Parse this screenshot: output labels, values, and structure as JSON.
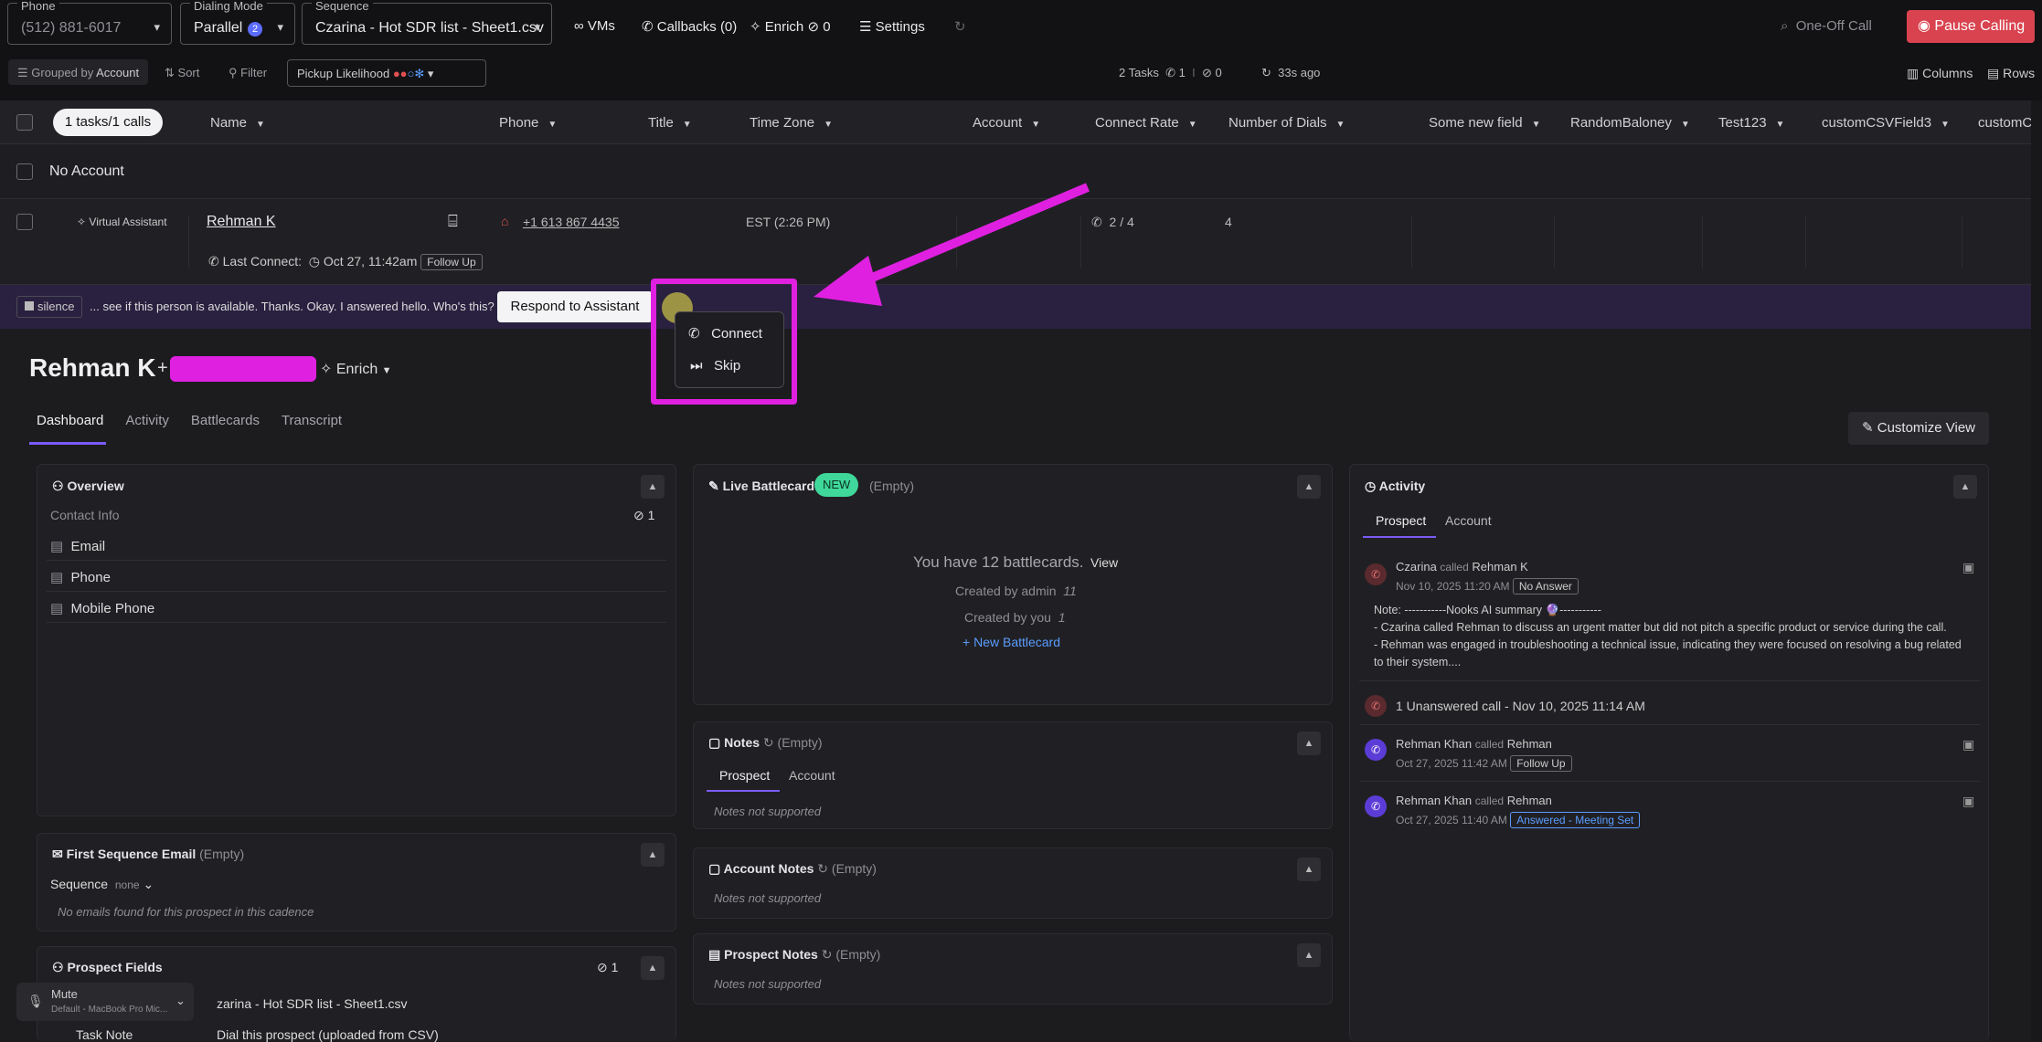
{
  "topbar": {
    "phone": {
      "label": "Phone",
      "value": "(512) 881-6017"
    },
    "dialing_mode": {
      "label": "Dialing Mode",
      "value": "Parallel",
      "count": "2"
    },
    "sequence": {
      "label": "Sequence",
      "value": "Czarina - Hot SDR list - Sheet1.csv"
    },
    "vms": "VMs",
    "callbacks": "Callbacks (0)",
    "enrich": "Enrich",
    "enrich_count": "0",
    "settings": "Settings",
    "one_off_call": "One-Off Call",
    "pause_calling": "Pause Calling"
  },
  "toolbar": {
    "grouped_by": "Grouped by",
    "grouped_value": "Account",
    "sort": "Sort",
    "filter": "Filter",
    "pickup": "Pickup Likelihood",
    "tasks": "2 Tasks",
    "phone_count": "1",
    "divider": "I",
    "hidden_count": "0",
    "ago": "33s ago",
    "columns": "Columns",
    "rows": "Rows"
  },
  "table": {
    "pill": "1 tasks/1 calls",
    "headers": [
      "Name",
      "Phone",
      "Title",
      "Time Zone",
      "Account",
      "Connect Rate",
      "Number of Dials",
      "Some new field",
      "RandomBaloney",
      "Test123",
      "customCSVField3",
      "customCS"
    ],
    "group": "No Account",
    "row": {
      "badge": "Virtual Assistant",
      "name": "Rehman K",
      "phone": "+1 613 867 4435",
      "timezone": "EST (2:26 PM)",
      "connect": "2 / 4",
      "dials": "4",
      "last_connect_label": "Last Connect:",
      "last_connect": "Oct 27, 11:42am",
      "status": "Follow Up"
    }
  },
  "assistant": {
    "silence": "silence",
    "transcript": "... see if this person is available. Thanks. Okay. I answered hello. Who's this?",
    "respond": "Respond to Assistant",
    "menu": [
      "Connect",
      "Skip"
    ]
  },
  "prospect": {
    "name": "Rehman K",
    "enrich": "Enrich",
    "tabs": [
      "Dashboard",
      "Activity",
      "Battlecards",
      "Transcript"
    ],
    "customize": "Customize View"
  },
  "overview": {
    "title": "Overview",
    "contact_info": "Contact Info",
    "hidden": "1",
    "items": [
      "Email",
      "Phone",
      "Mobile Phone"
    ]
  },
  "first_email": {
    "title": "First Sequence Email",
    "empty": "(Empty)",
    "sequence_label": "Sequence",
    "sequence_value": "none",
    "no_emails": "No emails found for this prospect in this cadence"
  },
  "prospect_fields": {
    "title": "Prospect Fields",
    "hidden": "1",
    "row1": "zarina - Hot SDR list - Sheet1.csv",
    "row2_label": "Task Note",
    "row2_value": "Dial this prospect (uploaded from CSV)"
  },
  "mute": {
    "label": "Mute",
    "device": "Default - MacBook Pro Mic..."
  },
  "battlecard": {
    "title": "Live Battlecard",
    "new": "NEW",
    "empty": "(Empty)",
    "count_text": "You have 12 battlecards.",
    "view": "View",
    "by_admin": "Created by admin",
    "admin_n": "11",
    "by_you": "Created by you",
    "you_n": "1",
    "new_btn": "New Battlecard"
  },
  "notes": {
    "title": "Notes",
    "empty": "(Empty)",
    "tabs": [
      "Prospect",
      "Account"
    ],
    "unsupported": "Notes not supported"
  },
  "account_notes": {
    "title": "Account Notes",
    "empty": "(Empty)",
    "unsupported": "Notes not supported"
  },
  "prospect_notes": {
    "title": "Prospect Notes",
    "empty": "(Empty)",
    "unsupported": "Notes not supported"
  },
  "activity": {
    "title": "Activity",
    "tabs": [
      "Prospect",
      "Account"
    ],
    "e1": {
      "who": "Czarina",
      "verb": "called",
      "target": "Rehman K",
      "time": "Nov 10, 2025 11:20 AM",
      "tag": "No Answer",
      "note_head": "Note: -----------Nooks AI summary 🔮-----------",
      "note1": "- Czarina called Rehman to discuss an urgent matter but did not pitch a specific product or service during the call.",
      "note2": "- Rehman was engaged in troubleshooting a technical issue, indicating they were focused on resolving a bug related",
      "note3": "to their system...."
    },
    "e2": {
      "text": "1 Unanswered call - Nov 10, 2025 11:14 AM"
    },
    "e3": {
      "who": "Rehman Khan",
      "verb": "called",
      "target": "Rehman",
      "time": "Oct 27, 2025 11:42 AM",
      "tag": "Follow Up"
    },
    "e4": {
      "who": "Rehman Khan",
      "verb": "called",
      "target": "Rehman",
      "time": "Oct 27, 2025 11:40 AM",
      "tag": "Answered - Meeting Set"
    }
  },
  "colors": {
    "accent": "#7b5cf5",
    "pause": "#d9434f",
    "highlight": "#e020e0",
    "new_badge": "#3fd89a",
    "link": "#5b9cff"
  }
}
